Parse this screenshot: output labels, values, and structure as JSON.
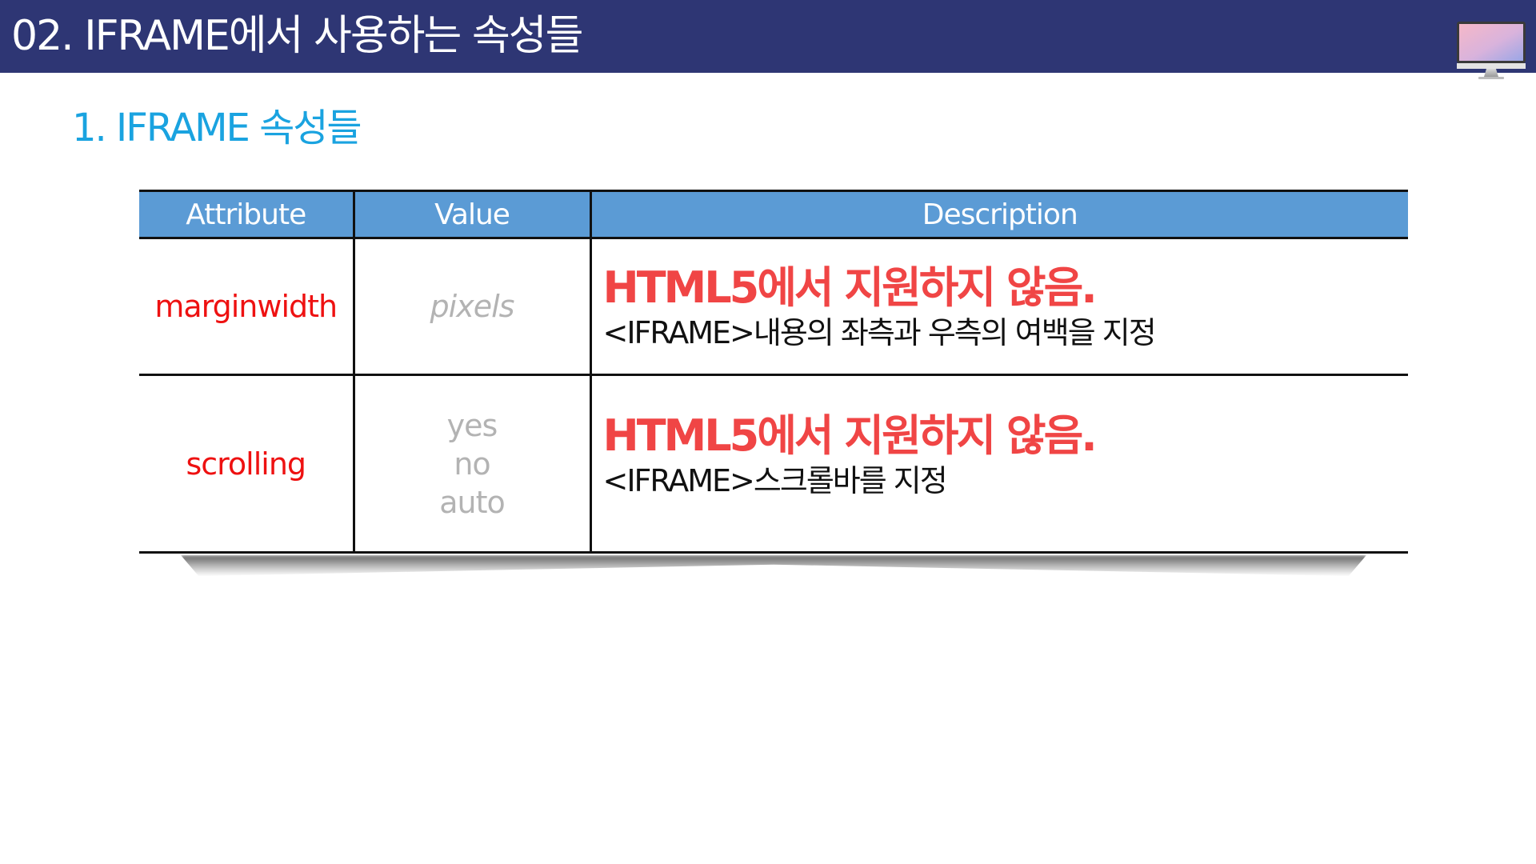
{
  "header": {
    "title": "02. IFRAME에서 사용하는 속성들",
    "icon": "monitor-icon",
    "background_color": "#2e3674"
  },
  "section": {
    "title": "1. IFRAME 속성들",
    "color": "#1aa3e0"
  },
  "table": {
    "header_color": "#5b9bd5",
    "columns": [
      "Attribute",
      "Value",
      "Description"
    ],
    "rows": [
      {
        "attribute": "marginwidth",
        "values": [
          "pixels"
        ],
        "description_main": "HTML5에서 지원하지 않음.",
        "description_sub": "<IFRAME>내용의 좌측과 우측의 여백을 지정"
      },
      {
        "attribute": "scrolling",
        "values": [
          "yes",
          "no",
          "auto"
        ],
        "description_main": "HTML5에서 지원하지 않음.",
        "description_sub": "<IFRAME>스크롤바를 지정"
      }
    ]
  }
}
